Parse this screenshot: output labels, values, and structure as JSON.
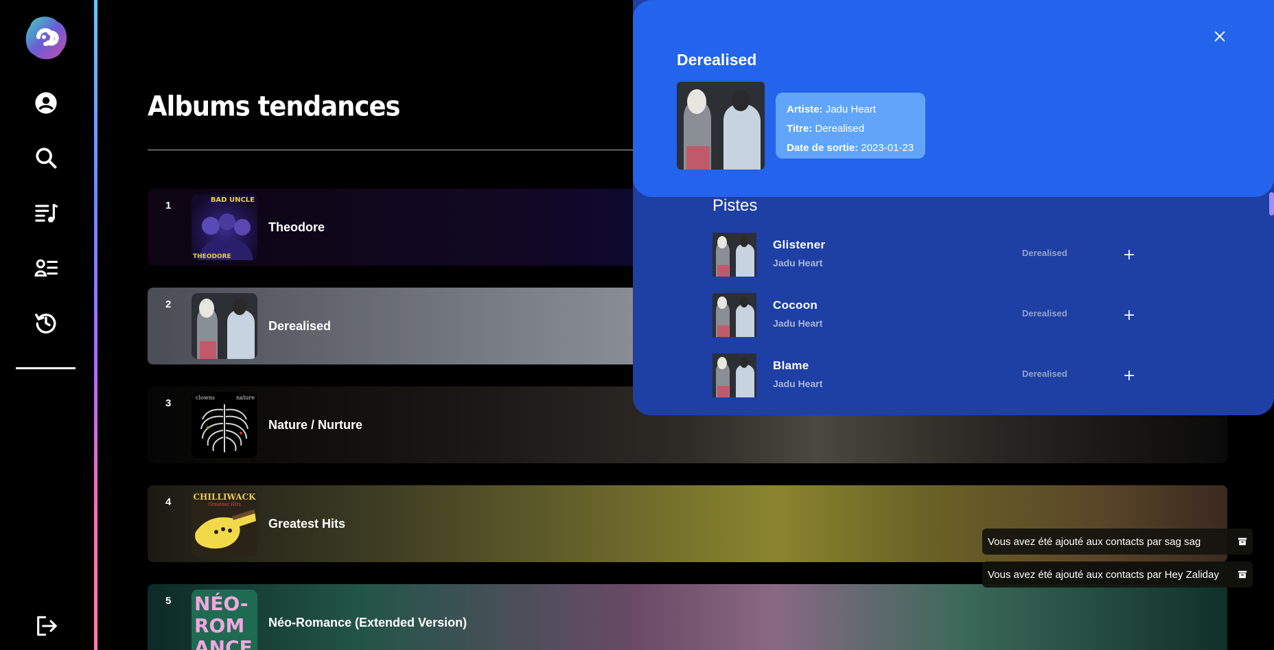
{
  "sidebar": {
    "logo": "app-logo",
    "items": [
      {
        "icon": "user-circle-icon",
        "name": "nav-profile"
      },
      {
        "icon": "search-icon",
        "name": "nav-search"
      },
      {
        "icon": "playlist-icon",
        "name": "nav-playlists"
      },
      {
        "icon": "contacts-icon",
        "name": "nav-contacts"
      },
      {
        "icon": "history-icon",
        "name": "nav-history"
      }
    ],
    "logout_icon": "logout-icon"
  },
  "main": {
    "title": "Albums tendances",
    "albums": [
      {
        "rank": "1",
        "name": "Theodore"
      },
      {
        "rank": "2",
        "name": "Derealised"
      },
      {
        "rank": "3",
        "name": "Nature / Nurture"
      },
      {
        "rank": "4",
        "name": "Greatest Hits"
      },
      {
        "rank": "5",
        "name": "Néo-Romance (Extended Version)"
      }
    ]
  },
  "popup": {
    "title": "Derealised",
    "info": {
      "artist_label": "Artiste:",
      "artist_value": "Jadu Heart",
      "title_label": "Titre:",
      "title_value": "Derealised",
      "date_label": "Date de sortie:",
      "date_value": "2023-01-23"
    },
    "tracks_heading": "Pistes",
    "tracks": [
      {
        "name": "Glistener",
        "artist": "Jadu Heart",
        "album": "Derealised"
      },
      {
        "name": "Cocoon",
        "artist": "Jadu Heart",
        "album": "Derealised"
      },
      {
        "name": "Blame",
        "artist": "Jadu Heart",
        "album": "Derealised"
      }
    ]
  },
  "toasts": [
    {
      "text": "Vous avez été ajouté aux contacts par sag sag"
    },
    {
      "text": "Vous avez été ajouté aux contacts par Hey Zaliday"
    }
  ],
  "cover_texts": {
    "theodore_band": "BAD UNCLE",
    "theodore_title": "THEODORE",
    "nature_left": "clowns",
    "nature_right": "nature",
    "chilliwack_band": "CHILLIWACK",
    "chilliwack_sub": "Greatest Hits",
    "neo_line1": "NÉO-",
    "neo_line2": "ROM",
    "neo_line3": "ANCE"
  },
  "colors": {
    "accent_blue": "#2463eb",
    "popup_body": "#1e3fa4",
    "info_card": "#60a5fa"
  }
}
